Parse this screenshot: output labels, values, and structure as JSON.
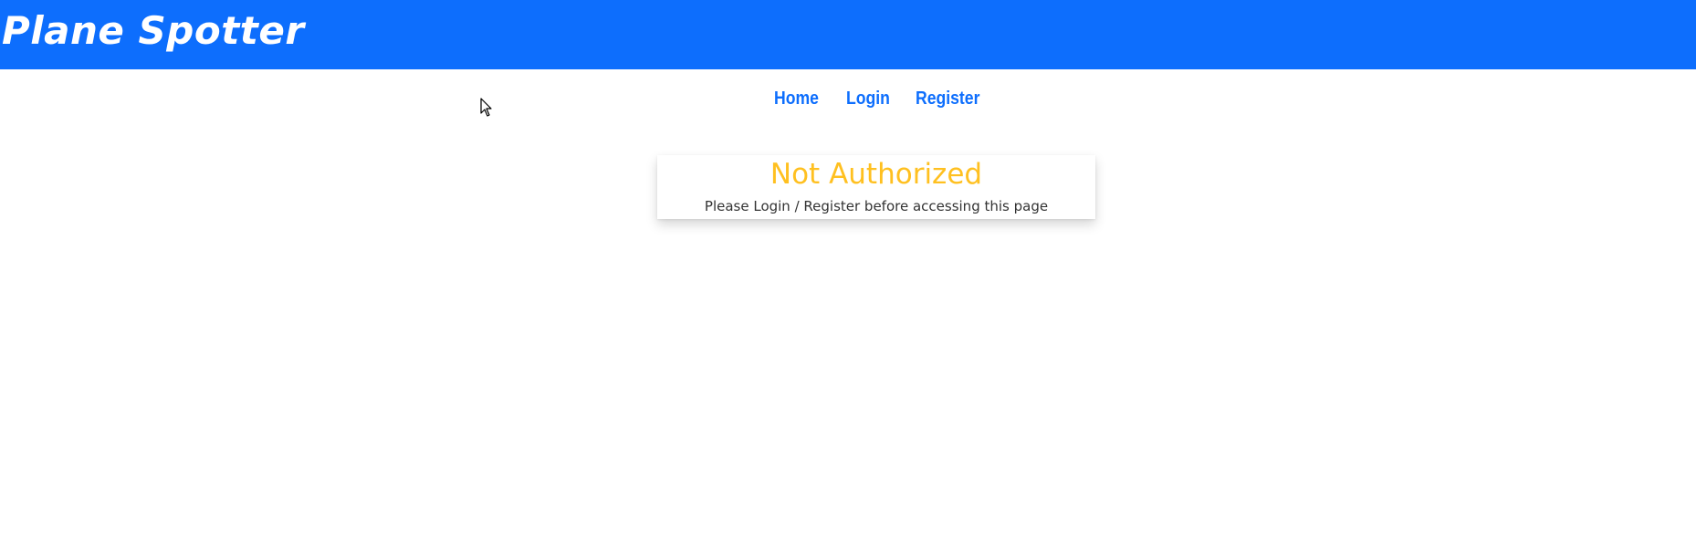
{
  "header": {
    "brand": "Plane Spotter",
    "background_color": "#0d6efd"
  },
  "nav": {
    "items": [
      {
        "label": "Home"
      },
      {
        "label": "Login"
      },
      {
        "label": "Register"
      }
    ],
    "link_color": "#0d6efd"
  },
  "alert": {
    "title": "Not Authorized",
    "message": "Please Login / Register before accessing this page",
    "title_color": "#ffc020"
  },
  "cursor": {
    "icon": "mouse-pointer-icon"
  }
}
